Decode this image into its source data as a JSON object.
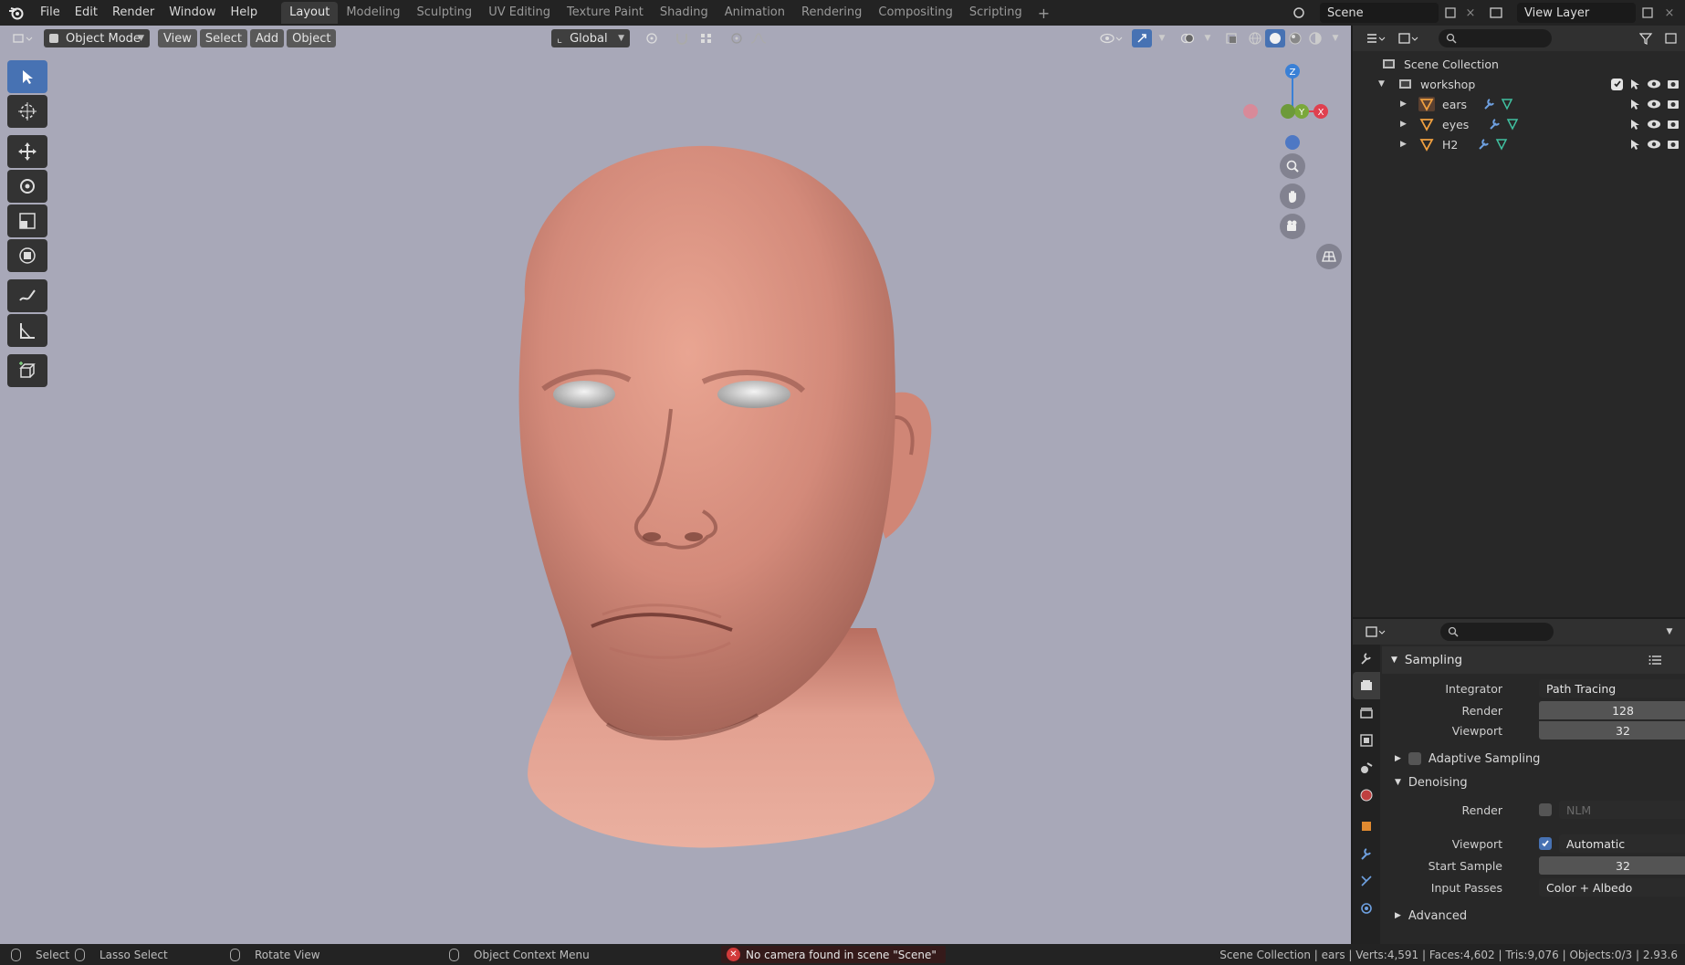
{
  "menu": [
    "File",
    "Edit",
    "Render",
    "Window",
    "Help"
  ],
  "workspaces": [
    "Layout",
    "Modeling",
    "Sculpting",
    "UV Editing",
    "Texture Paint",
    "Shading",
    "Animation",
    "Rendering",
    "Compositing",
    "Scripting"
  ],
  "active_workspace": "Layout",
  "add_workspace": "+",
  "scene_name": "Scene",
  "view_layer": "View Layer",
  "viewport": {
    "mode": "Object Mode",
    "menus": [
      "View",
      "Select",
      "Add",
      "Object"
    ],
    "transform_orientation": "Global",
    "background_color": "#a8a8b8",
    "skin_color": "#d98f80"
  },
  "gizmo": {
    "z": "Z",
    "y": "Y",
    "x": "X"
  },
  "outliner": {
    "root": "Scene Collection",
    "collection": "workshop",
    "objects": [
      {
        "name": "ears"
      },
      {
        "name": "eyes"
      },
      {
        "name": "H2"
      }
    ]
  },
  "properties": {
    "panel": "Sampling",
    "integrator_label": "Integrator",
    "integrator": "Path Tracing",
    "render_label": "Render",
    "render_samples": "128",
    "viewport_label": "Viewport",
    "viewport_samples": "32",
    "adaptive_sampling": "Adaptive Sampling",
    "denoising": "Denoising",
    "denoise_render_label": "Render",
    "denoise_render_value": "NLM",
    "denoise_viewport_label": "Viewport",
    "denoise_viewport_value": "Automatic",
    "start_sample_label": "Start Sample",
    "start_sample": "32",
    "input_passes_label": "Input Passes",
    "input_passes": "Color + Albedo",
    "advanced": "Advanced"
  },
  "status": {
    "select": "Select",
    "lasso": "Lasso Select",
    "rotate": "Rotate View",
    "context": "Object Context Menu",
    "warning": "No camera found in scene \"Scene\"",
    "stats": "Scene Collection | ears | Verts:4,591 | Faces:4,602 | Tris:9,076 | Objects:0/3 | 2.93.6"
  },
  "colors": {
    "accent": "#4772b3",
    "error": "#d23a3a",
    "gizmo_x": "#e0404f",
    "gizmo_y": "#7aa83a",
    "gizmo_z": "#3a80d6"
  }
}
